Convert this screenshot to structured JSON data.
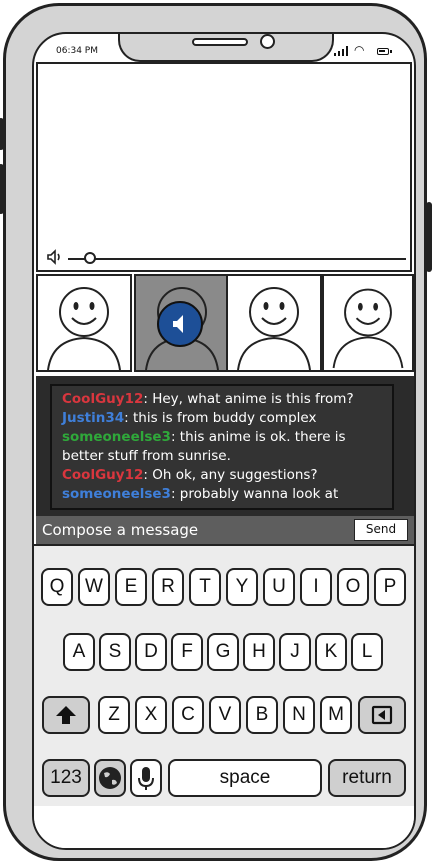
{
  "status": {
    "time": "06:34 PM"
  },
  "chat": {
    "messages": [
      {
        "user": "CoolGuy12",
        "user_color": "#d9363e",
        "text": ": Hey, what anime is this from?"
      },
      {
        "user": "Justin34",
        "user_color": "#3f7fd9",
        "text": ": this is from buddy complex"
      },
      {
        "user": "someoneelse3",
        "user_color": "#2fa83a",
        "text": ": this anime is ok. there is better stuff from sunrise."
      },
      {
        "user": "CoolGuy12",
        "user_color": "#d9363e",
        "text": ": Oh ok, any suggestions?"
      },
      {
        "user": "someoneelse3",
        "user_color": "#3f7fd9",
        "text": ": probably wanna look at"
      }
    ]
  },
  "compose": {
    "placeholder": "Compose a message",
    "send_label": "Send"
  },
  "keyboard": {
    "row1": [
      "Q",
      "W",
      "E",
      "R",
      "T",
      "Y",
      "U",
      "I",
      "O",
      "P"
    ],
    "row2": [
      "A",
      "S",
      "D",
      "F",
      "G",
      "H",
      "J",
      "K",
      "L"
    ],
    "row3": [
      "Z",
      "X",
      "C",
      "V",
      "B",
      "N",
      "M"
    ],
    "numbers_label": "123",
    "space_label": "space",
    "return_label": "return"
  },
  "icons": {
    "volume": "speaker-icon",
    "speaking": "speaker-icon",
    "shift": "shift-arrow-icon",
    "backspace": "backspace-icon",
    "globe": "globe-icon",
    "mic": "microphone-icon"
  },
  "colors": {
    "speaking_indicator": "#1d4f97",
    "chat_bg": "#333333",
    "compose_bg": "#5e5e5e"
  }
}
